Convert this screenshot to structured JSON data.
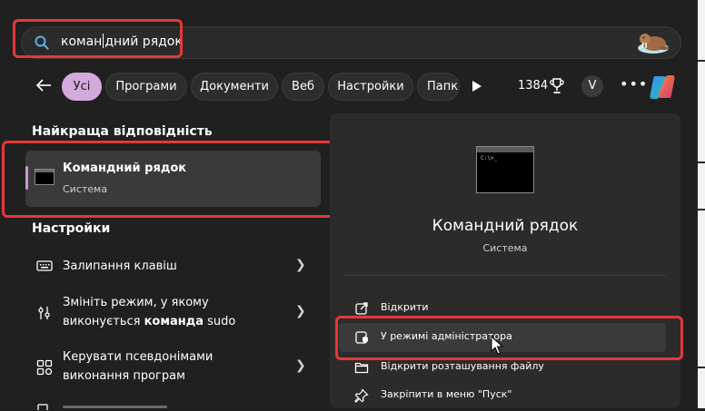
{
  "search": {
    "typed": "коман",
    "rest": "дний рядок",
    "walrus_icon": "walrus-icon"
  },
  "filters": {
    "tabs": [
      {
        "label": "Усі",
        "active": true
      },
      {
        "label": "Програми",
        "active": false
      },
      {
        "label": "Документи",
        "active": false
      },
      {
        "label": "Веб",
        "active": false
      },
      {
        "label": "Настройки",
        "active": false
      },
      {
        "label": "Папк",
        "active": false
      }
    ],
    "points": "1384",
    "avatar": "V",
    "more": "•••"
  },
  "best_match": {
    "heading": "Найкраща відповідність",
    "title": "Командний рядок",
    "subtitle": "Система"
  },
  "settings": {
    "heading": "Настройки",
    "items": [
      {
        "line1": "Залипання клавіш",
        "icon": "keyboard-icon"
      },
      {
        "line1_pre": "Змініть режим, у якому",
        "line2_pre": "виконується ",
        "line2_bold": "команда",
        "line2_post": " sudo",
        "icon": "sudo-icon"
      },
      {
        "line1": "Керувати псевдонімами",
        "line2": "виконання програм",
        "icon": "app-alias-icon"
      },
      {
        "line1": "",
        "icon": "partial-icon"
      }
    ]
  },
  "preview": {
    "title": "Командний рядок",
    "subtitle": "Система",
    "actions": [
      {
        "label": "Відкрити",
        "icon": "open-icon"
      },
      {
        "label": "У режимі адміністратора",
        "icon": "admin-shield-icon"
      },
      {
        "label": "Відкрити розташування файлу",
        "icon": "folder-icon"
      },
      {
        "label": "Закріпити в меню \"Пуск\"",
        "icon": "pin-icon"
      }
    ]
  },
  "colors": {
    "accent": "#d4a9dd",
    "highlight_box": "#e5373a",
    "panel": "#202020"
  }
}
